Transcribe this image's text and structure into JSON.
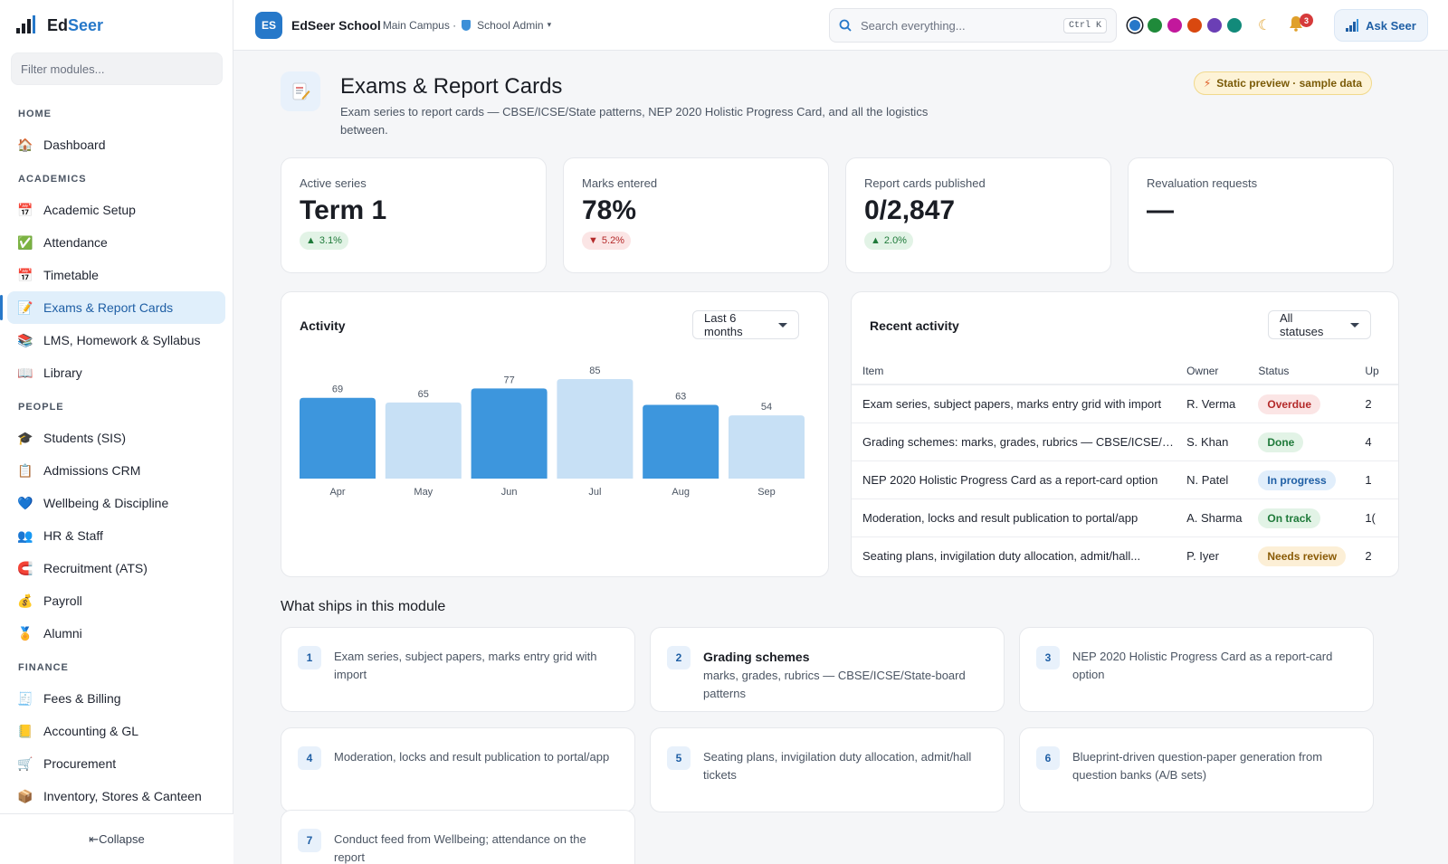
{
  "brand": {
    "name_a": "Ed",
    "name_b": "Seer"
  },
  "sidebar": {
    "filter_placeholder": "Filter modules...",
    "sections": [
      {
        "title": "HOME",
        "items": [
          {
            "label": "Dashboard",
            "icon": "home-icon"
          }
        ]
      },
      {
        "title": "ACADEMICS",
        "items": [
          {
            "label": "Academic Setup",
            "icon": "calendar-icon"
          },
          {
            "label": "Attendance",
            "icon": "check-icon"
          },
          {
            "label": "Timetable",
            "icon": "calendar-icon"
          },
          {
            "label": "Exams & Report Cards",
            "icon": "memo-icon",
            "active": true
          },
          {
            "label": "LMS, Homework & Syllabus",
            "icon": "books-icon"
          },
          {
            "label": "Library",
            "icon": "open-book-icon"
          }
        ]
      },
      {
        "title": "PEOPLE",
        "items": [
          {
            "label": "Students (SIS)",
            "icon": "graduation-cap-icon"
          },
          {
            "label": "Admissions CRM",
            "icon": "clipboard-icon"
          },
          {
            "label": "Wellbeing & Discipline",
            "icon": "heart-icon"
          },
          {
            "label": "HR & Staff",
            "icon": "people-icon"
          },
          {
            "label": "Recruitment (ATS)",
            "icon": "magnet-icon"
          },
          {
            "label": "Payroll",
            "icon": "money-bag-icon"
          },
          {
            "label": "Alumni",
            "icon": "medal-icon"
          }
        ]
      },
      {
        "title": "FINANCE",
        "items": [
          {
            "label": "Fees & Billing",
            "icon": "receipt-icon"
          },
          {
            "label": "Accounting & GL",
            "icon": "ledger-icon"
          },
          {
            "label": "Procurement",
            "icon": "cart-icon"
          },
          {
            "label": "Inventory, Stores & Canteen",
            "icon": "package-icon"
          }
        ]
      }
    ],
    "collapse_label": "⇤Collapse"
  },
  "topbar": {
    "school_initials": "ES",
    "school_name": "EdSeer School",
    "campus": "Main Campus ·",
    "role": "School Admin",
    "search_placeholder": "Search everything...",
    "search_shortcut": "Ctrl K",
    "theme_colors": [
      "#2678c9",
      "#1f8a3a",
      "#c2189c",
      "#d9480f",
      "#6b3fb5",
      "#128a7a"
    ],
    "notification_count": "3",
    "ask_label": "Ask Seer"
  },
  "page": {
    "title": "Exams & Report Cards",
    "subtitle": "Exam series to report cards — CBSE/ICSE/State patterns, NEP 2020 Holistic Progress Card, and all the logistics between.",
    "preview_badge": "Static preview · sample data"
  },
  "stats": [
    {
      "label": "Active series",
      "value": "Term 1",
      "delta": "3.1%",
      "direction": "up"
    },
    {
      "label": "Marks entered",
      "value": "78%",
      "delta": "5.2%",
      "direction": "down"
    },
    {
      "label": "Report cards published",
      "value": "0/2,847",
      "delta": "2.0%",
      "direction": "up"
    },
    {
      "label": "Revaluation requests",
      "value": "—",
      "delta": "",
      "direction": "none"
    }
  ],
  "activity": {
    "title": "Activity",
    "range": "Last 6 months"
  },
  "chart_data": {
    "type": "bar",
    "categories": [
      "Apr",
      "May",
      "Jun",
      "Jul",
      "Aug",
      "Sep"
    ],
    "values": [
      69,
      65,
      77,
      85,
      63,
      54
    ],
    "ylim": [
      0,
      85
    ],
    "colors": [
      "#3d96dd",
      "#c7e0f5",
      "#3d96dd",
      "#c7e0f5",
      "#3d96dd",
      "#c7e0f5"
    ]
  },
  "recent": {
    "title": "Recent activity",
    "filter": "All statuses",
    "columns": [
      "Item",
      "Owner",
      "Status",
      "Up"
    ],
    "rows": [
      {
        "item": "Exam series, subject papers, marks entry grid with import",
        "owner": "R. Verma",
        "status": "Overdue",
        "kind": "overdue",
        "up": "2"
      },
      {
        "item": "Grading schemes: marks, grades, rubrics — CBSE/ICSE/State-board patterns",
        "owner": "S. Khan",
        "status": "Done",
        "kind": "done",
        "up": "4"
      },
      {
        "item": "NEP 2020 Holistic Progress Card as a report-card option",
        "owner": "N. Patel",
        "status": "In progress",
        "kind": "progress",
        "up": "1"
      },
      {
        "item": "Moderation, locks and result publication to portal/app",
        "owner": "A. Sharma",
        "status": "On track",
        "kind": "track",
        "up": "1("
      },
      {
        "item": "Seating plans, invigilation duty allocation, admit/hall...",
        "owner": "P. Iyer",
        "status": "Needs review",
        "kind": "review",
        "up": "2"
      }
    ]
  },
  "ships": {
    "title": "What ships in this module",
    "items": [
      {
        "n": "1",
        "head": "",
        "text": "Exam series, subject papers, marks entry grid with import"
      },
      {
        "n": "2",
        "head": "Grading schemes",
        "text": "marks, grades, rubrics — CBSE/ICSE/State-board patterns"
      },
      {
        "n": "3",
        "head": "",
        "text": "NEP 2020 Holistic Progress Card as a report-card option"
      },
      {
        "n": "4",
        "head": "",
        "text": "Moderation, locks and result publication to portal/app"
      },
      {
        "n": "5",
        "head": "",
        "text": "Seating plans, invigilation duty allocation, admit/hall tickets"
      },
      {
        "n": "6",
        "head": "",
        "text": "Blueprint-driven question-paper generation from question banks (A/B sets)"
      },
      {
        "n": "7",
        "head": "",
        "text": "Conduct feed from Wellbeing; attendance on the report"
      }
    ]
  }
}
